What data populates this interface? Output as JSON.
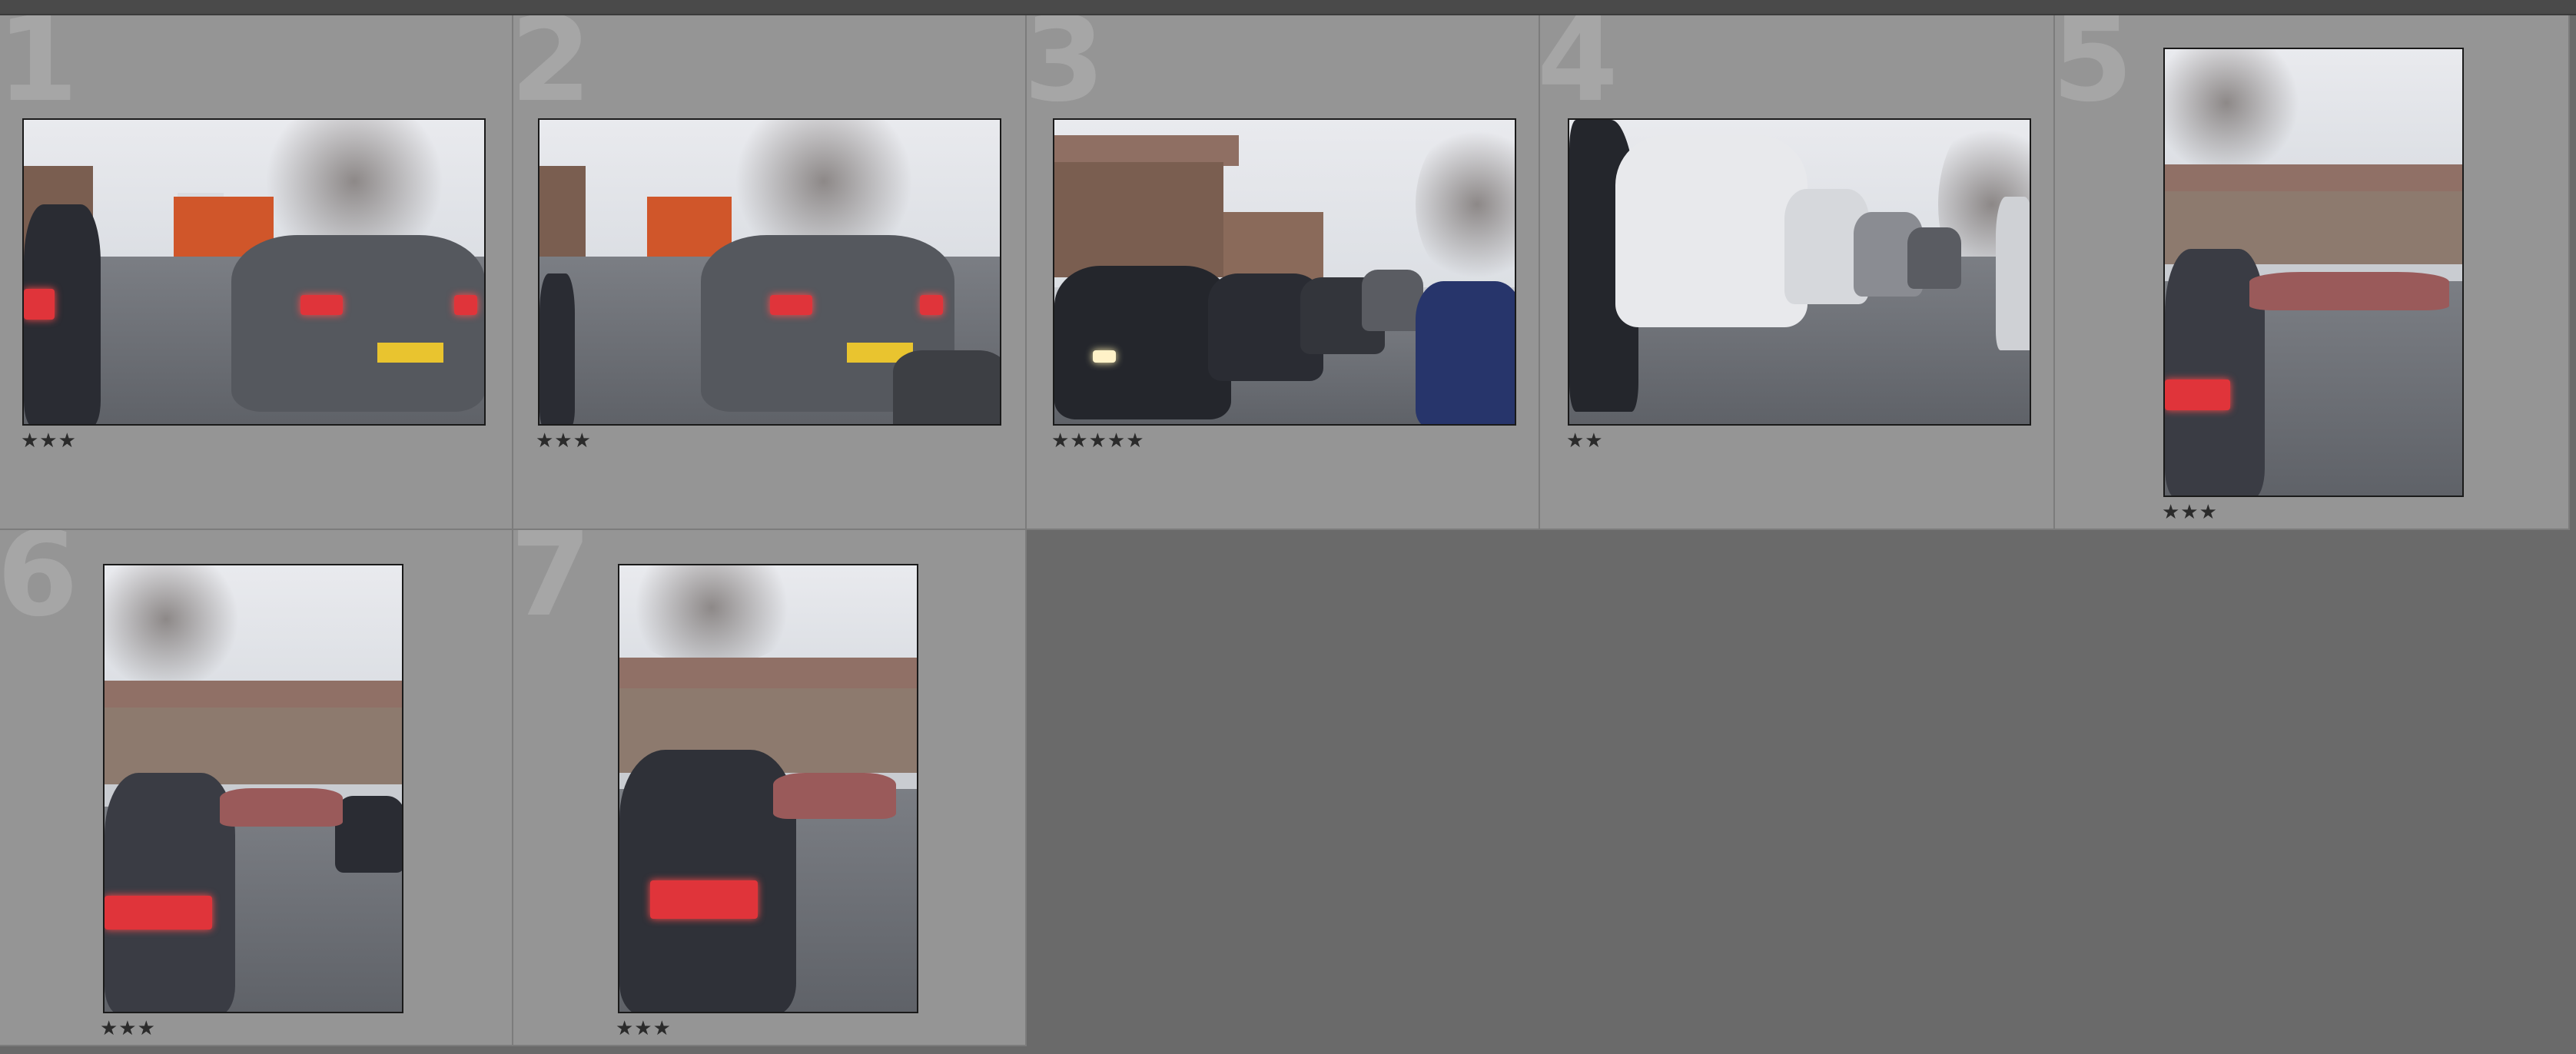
{
  "grid": {
    "cells": [
      {
        "number": "1",
        "rating": "★★★",
        "subject": "traffic-queue-rear-view"
      },
      {
        "number": "2",
        "rating": "★★★",
        "subject": "traffic-queue-rear-view"
      },
      {
        "number": "3",
        "rating": "★★★★★",
        "subject": "traffic-queue-front-view"
      },
      {
        "number": "4",
        "rating": "★★",
        "subject": "traffic-queue-front-view"
      },
      {
        "number": "5",
        "rating": "★★★",
        "subject": "traffic-queue-portrait"
      },
      {
        "number": "6",
        "rating": "★★★",
        "subject": "traffic-queue-portrait"
      },
      {
        "number": "7",
        "rating": "★★★",
        "subject": "traffic-queue-portrait"
      }
    ]
  },
  "colors": {
    "cell_background": "#959595",
    "empty_background": "#6a6a6a",
    "cell_number": "#a6a6a6",
    "star": "#2b2b2b"
  }
}
